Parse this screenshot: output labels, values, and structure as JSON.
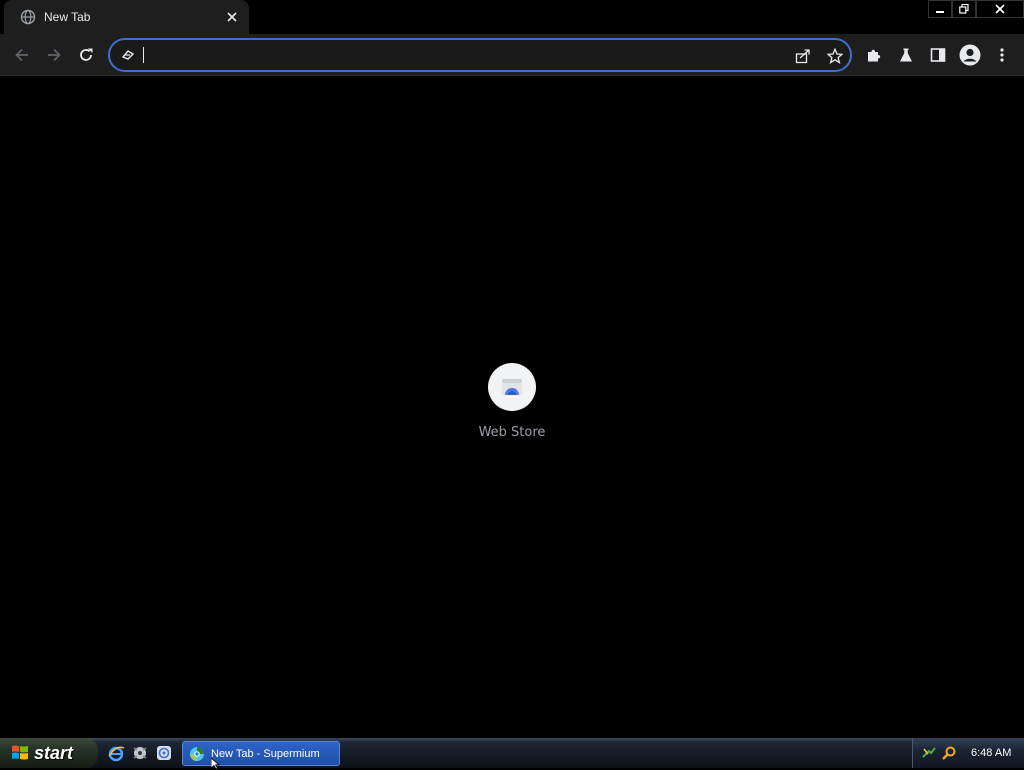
{
  "browser": {
    "tab": {
      "title": "New Tab",
      "favicon": "globe-icon",
      "close": "×"
    },
    "window_controls": [
      "minimize-icon",
      "restore-icon",
      "close-icon"
    ],
    "toolbar": {
      "back": "arrow-left-icon",
      "forward": "arrow-right-icon",
      "reload": "reload-icon",
      "omnibox": {
        "value": "",
        "site_icon": "site-info-icon",
        "share": "share-icon",
        "bookmark": "star-icon"
      },
      "extensions": "puzzle-icon",
      "labs": "flask-icon",
      "side_panel": "side-panel-icon",
      "profile": "avatar-icon",
      "menu": "kebab-menu-icon"
    },
    "colors": {
      "focus_ring": "#3d6fcc",
      "toolbar_bg": "#1e1e1e",
      "page_bg": "#000000"
    }
  },
  "new_tab_page": {
    "shortcuts": [
      {
        "label": "Web Store",
        "icon": "web-store-icon"
      }
    ]
  },
  "taskbar": {
    "start_label": "start",
    "quick_launch": [
      "internet-explorer-icon",
      "media-icon",
      "browser-icon"
    ],
    "tasks": [
      {
        "label": "New Tab - Supermium",
        "icon": "supermium-icon"
      }
    ],
    "tray_icons": [
      "network-icon",
      "search-icon"
    ],
    "clock": "6:48 AM"
  }
}
